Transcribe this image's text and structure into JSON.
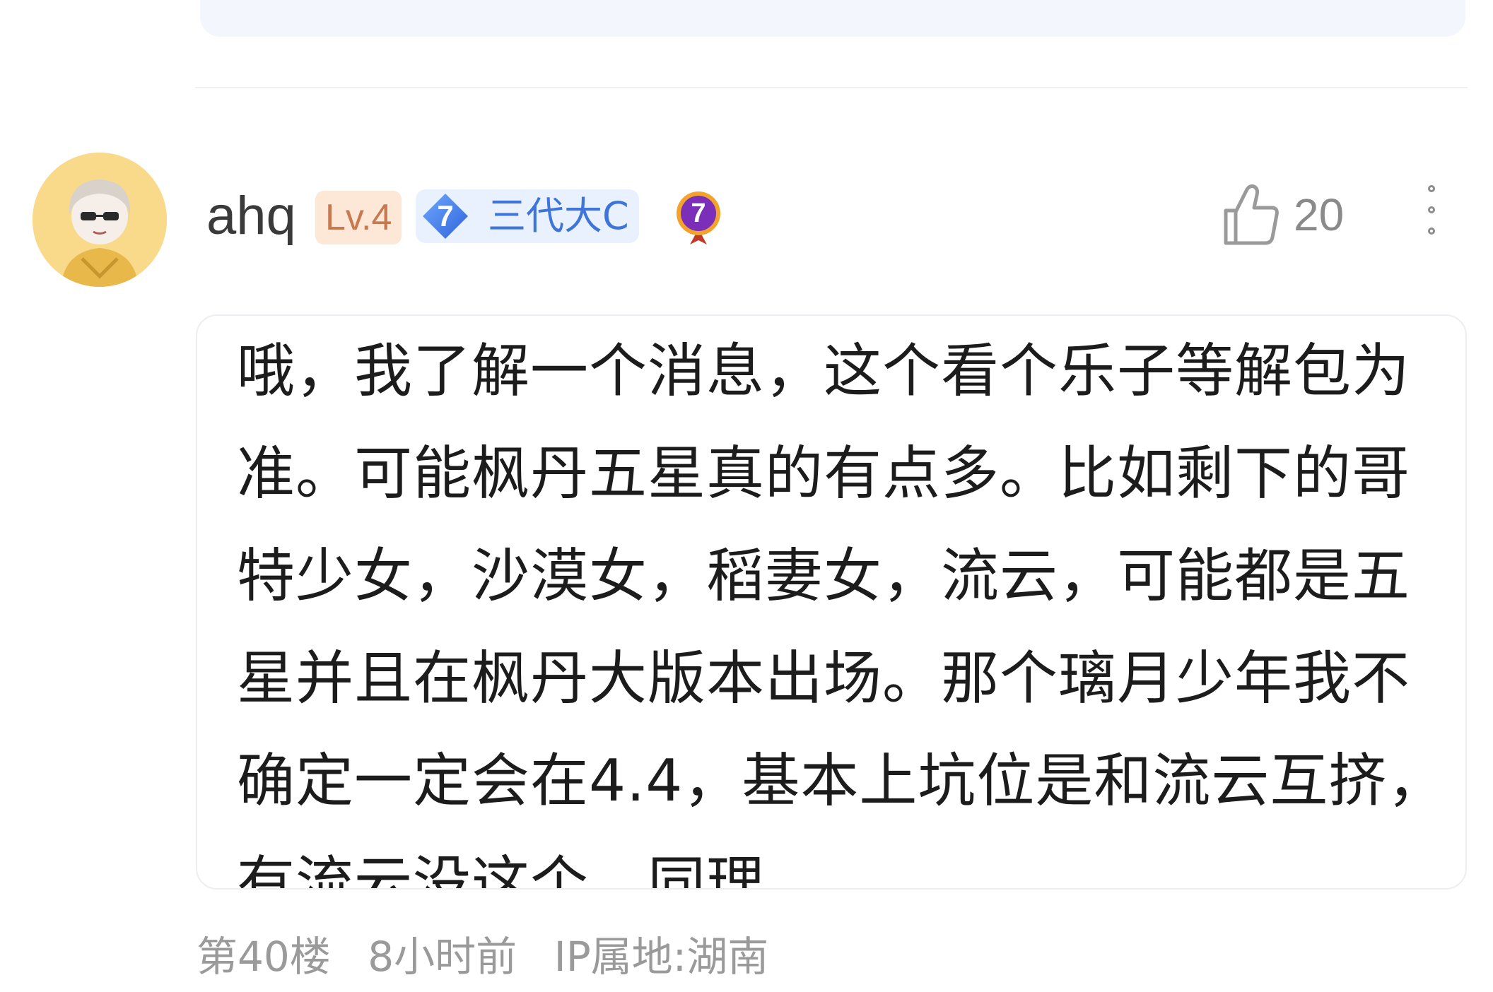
{
  "comment": {
    "author": "ahq",
    "level_badge": "Lv.4",
    "tier_badge": {
      "number": "7",
      "label": "三代大C"
    },
    "medal_number": "7",
    "likes": "20",
    "text": "哦，我了解一个消息，这个看个乐子等解包为准。可能枫丹五星真的有点多。比如剩下的哥特少女，沙漠女，稻妻女，流云，可能都是五星并且在枫丹大版本出场。那个璃月少年我不确定一定会在4.4，基本上坑位是和流云互挤，有流云没这个，同理。",
    "floor": "第40楼",
    "time": "8小时前",
    "ip": "IP属地:湖南"
  },
  "icons": {
    "like": "thumbs-up-icon",
    "more": "more-vertical-icon",
    "tier": "diamond-icon",
    "medal": "medal-icon"
  },
  "colors": {
    "level_badge_bg": "#fde8d7",
    "level_badge_text": "#c57a52",
    "tier_badge_bg": "#e9f1fe",
    "tier_badge_text": "#3f74d8",
    "meta_text": "#9a9a9a"
  }
}
